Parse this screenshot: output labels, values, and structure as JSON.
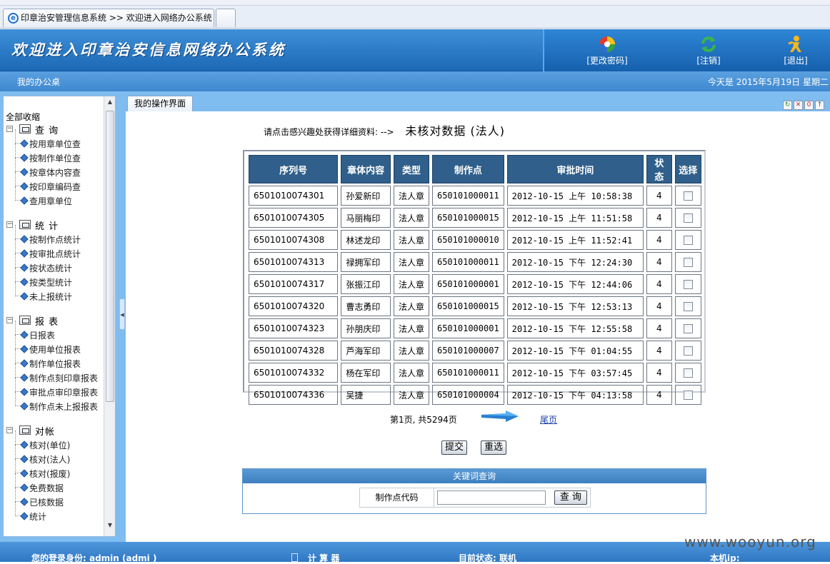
{
  "browser": {
    "tab_title": "印章治安管理信息系统 >> 欢迎进入网络办公系统"
  },
  "header": {
    "title": "欢迎进入印章治安信息网络办公系统",
    "buttons": [
      {
        "label": "[更改密码]",
        "icon": "color-wheel-icon"
      },
      {
        "label": "[注销]",
        "icon": "refresh-icon"
      },
      {
        "label": "[退出]",
        "icon": "exit-person-icon"
      }
    ]
  },
  "navbar": {
    "left": "我的办公桌",
    "right": "今天是 2015年5月19日 星期二"
  },
  "sidebar": {
    "collapse_all": "全部收缩",
    "groups": [
      {
        "title": "查 询",
        "items": [
          "按用章单位查",
          "按制作单位查",
          "按章体内容查",
          "按印章编码查",
          "查用章单位"
        ]
      },
      {
        "title": "统 计",
        "items": [
          "按制作点统计",
          "按审批点统计",
          "按状态统计",
          "按类型统计",
          "未上报统计"
        ]
      },
      {
        "title": "报 表",
        "items": [
          "日报表",
          "使用单位报表",
          "制作单位报表",
          "制作点刻印章报表",
          "审批点审印章报表",
          "制作点未上报报表"
        ]
      },
      {
        "title": "对帐",
        "items": [
          "核对(单位)",
          "核对(法人)",
          "核对(报废)",
          "免费数据",
          "已核数据",
          "统计"
        ]
      }
    ]
  },
  "main": {
    "tab_label": "我的操作界面",
    "prompt": "请点击感兴趣处获得详细资料: -->",
    "prompt_title": "未核对数据 (法人)",
    "table": {
      "headers": [
        "序列号",
        "章体内容",
        "类型",
        "制作点",
        "审批时间",
        "状态",
        "选择"
      ],
      "rows": [
        [
          "6501010074301",
          "孙爱新印",
          "法人章",
          "650101000011",
          "2012-10-15 上午 10:58:38",
          "4"
        ],
        [
          "6501010074305",
          "马丽梅印",
          "法人章",
          "650101000015",
          "2012-10-15 上午 11:51:58",
          "4"
        ],
        [
          "6501010074308",
          "林述龙印",
          "法人章",
          "650101000010",
          "2012-10-15 上午 11:52:41",
          "4"
        ],
        [
          "6501010074313",
          "禄拥军印",
          "法人章",
          "650101000011",
          "2012-10-15 下午 12:24:30",
          "4"
        ],
        [
          "6501010074317",
          "张振江印",
          "法人章",
          "650101000001",
          "2012-10-15 下午 12:44:06",
          "4"
        ],
        [
          "6501010074320",
          "曹志勇印",
          "法人章",
          "650101000015",
          "2012-10-15 下午 12:53:13",
          "4"
        ],
        [
          "6501010074323",
          "孙朋庆印",
          "法人章",
          "650101000001",
          "2012-10-15 下午 12:55:58",
          "4"
        ],
        [
          "6501010074328",
          "芦海军印",
          "法人章",
          "650101000007",
          "2012-10-15 下午 01:04:55",
          "4"
        ],
        [
          "6501010074332",
          "杨在军印",
          "法人章",
          "650101000011",
          "2012-10-15 下午 03:57:45",
          "4"
        ],
        [
          "6501010074336",
          "吴捷",
          "法人章",
          "650101000004",
          "2012-10-15 下午 04:13:58",
          "4"
        ]
      ]
    },
    "pager": {
      "text": "第1页, 共5294页",
      "last": "尾页"
    },
    "submit_label": "提交",
    "reset_label": "重选",
    "keyword": {
      "heading": "关键词查询",
      "field_label": "制作点代码",
      "field_value": "",
      "search_label": "查 询"
    }
  },
  "footer": {
    "login": "您的登录身份: admin (admi )",
    "calculator": "计 算 器",
    "status": "目前状态: 联机",
    "ip": "本机ip:"
  },
  "watermark": "www.wooyun.org",
  "colors": {
    "header_blue": "#1c69b6",
    "table_header": "#2f5f8a",
    "frame_blue": "#7fbcf0"
  }
}
